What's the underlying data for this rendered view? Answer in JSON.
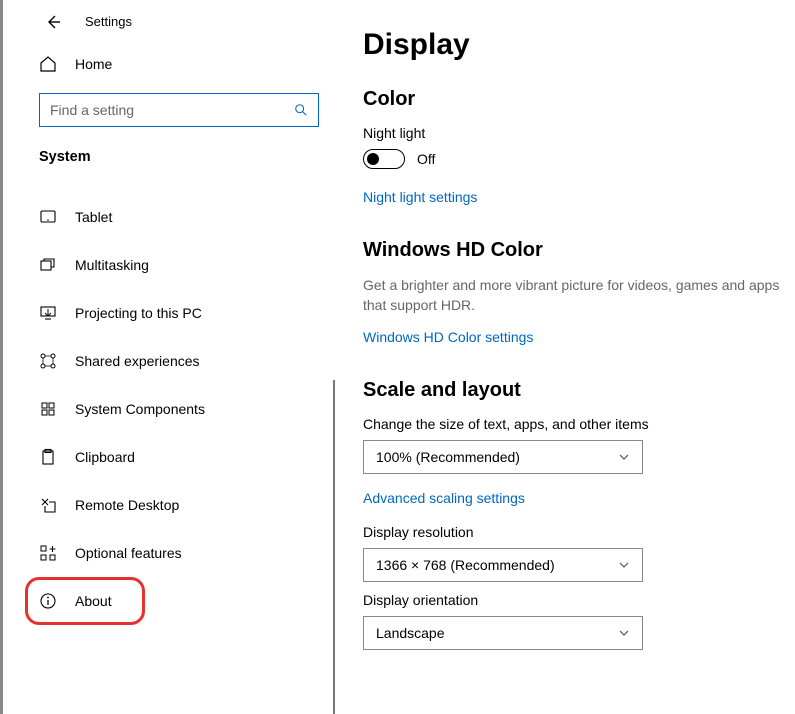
{
  "header": {
    "title": "Settings"
  },
  "home": {
    "label": "Home"
  },
  "search": {
    "placeholder": "Find a setting"
  },
  "section_label": "System",
  "nav": [
    {
      "label": "Tablet"
    },
    {
      "label": "Multitasking"
    },
    {
      "label": "Projecting to this PC"
    },
    {
      "label": "Shared experiences"
    },
    {
      "label": "System Components"
    },
    {
      "label": "Clipboard"
    },
    {
      "label": "Remote Desktop"
    },
    {
      "label": "Optional features"
    },
    {
      "label": "About"
    }
  ],
  "main": {
    "title": "Display",
    "color": {
      "heading": "Color",
      "night_light_label": "Night light",
      "night_light_state": "Off",
      "night_light_link": "Night light settings"
    },
    "hd": {
      "heading": "Windows HD Color",
      "desc": "Get a brighter and more vibrant picture for videos, games and apps that support HDR.",
      "link": "Windows HD Color settings"
    },
    "scale": {
      "heading": "Scale and layout",
      "size_label": "Change the size of text, apps, and other items",
      "size_value": "100% (Recommended)",
      "advanced_link": "Advanced scaling settings",
      "resolution_label": "Display resolution",
      "resolution_value": "1366 × 768 (Recommended)",
      "orientation_label": "Display orientation",
      "orientation_value": "Landscape"
    }
  }
}
